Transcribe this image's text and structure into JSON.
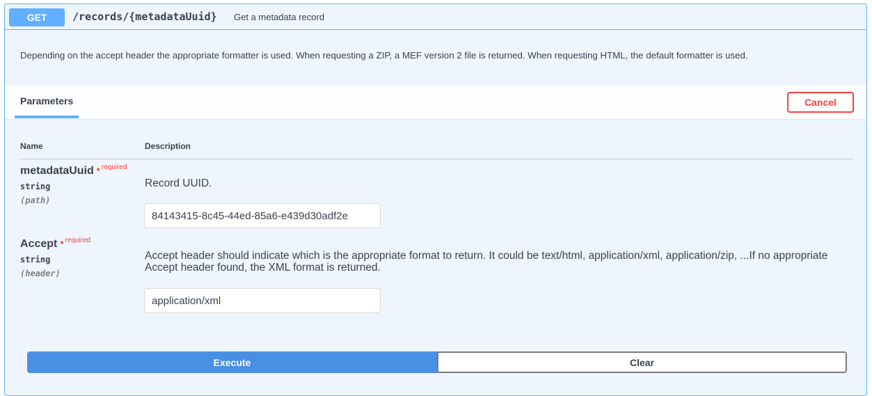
{
  "operation": {
    "method": "GET",
    "path": "/records/{metadataUuid}",
    "summary": "Get a metadata record",
    "description": "Depending on the accept header the appropriate formatter is used. When requesting a ZIP, a MEF version 2 file is returned. When requesting HTML, the default formatter is used."
  },
  "parameters_tab": {
    "label": "Parameters",
    "cancel_label": "Cancel"
  },
  "table": {
    "col_name": "Name",
    "col_description": "Description"
  },
  "params": [
    {
      "name": "metadataUuid",
      "required_star": "*",
      "required_label": "required",
      "type": "string",
      "in": "(path)",
      "description": "Record UUID.",
      "value": "84143415-8c45-44ed-85a6-e439d30adf2e"
    },
    {
      "name": "Accept",
      "required_star": "*",
      "required_label": "required",
      "type": "string",
      "in": "(header)",
      "description_line1": "Accept header should indicate which is the appropriate format to return. It could be text/html, application/xml, application/zip, ...If no appropriate",
      "description_line2": "Accept header found, the XML format is returned.",
      "value": "application/xml"
    }
  ],
  "actions": {
    "execute_label": "Execute",
    "clear_label": "Clear"
  },
  "colors": {
    "get_accent": "#61affe",
    "execute": "#4990e2",
    "cancel": "#f93e3e"
  }
}
